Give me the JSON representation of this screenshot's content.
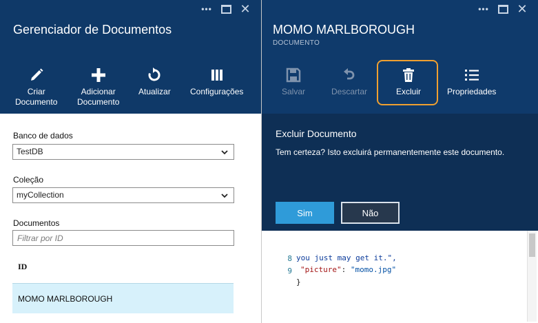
{
  "left_blade": {
    "title": "Gerenciador de Documentos",
    "window_controls": {
      "more": "•••"
    },
    "commands": [
      {
        "line1": "Criar",
        "line2": "Documento",
        "icon": "pencil-icon"
      },
      {
        "line1": "Adicionar",
        "line2": "Documento",
        "icon": "plus-icon"
      },
      {
        "line1": "Atualizar",
        "line2": "",
        "icon": "refresh-icon"
      },
      {
        "line1": "Configurações",
        "line2": "",
        "icon": "columns-icon"
      }
    ],
    "database": {
      "label": "Banco de dados",
      "value": "TestDB"
    },
    "collection": {
      "label": "Coleção",
      "value": "myCollection"
    },
    "documents": {
      "label": "Documentos",
      "placeholder": "Filtrar por ID",
      "column_header": "ID",
      "rows": [
        "MOMO MARLBOROUGH"
      ]
    }
  },
  "right_blade": {
    "title": "MOMO MARLBOROUGH",
    "subtitle": "DOCUMENTO",
    "window_controls": {
      "more": "•••"
    },
    "commands": [
      {
        "label": "Salvar",
        "icon": "save-icon",
        "enabled": false
      },
      {
        "label": "Descartar",
        "icon": "undo-icon",
        "enabled": false
      },
      {
        "label": "Excluir",
        "icon": "trash-icon",
        "enabled": true,
        "highlighted": true
      },
      {
        "label": "Propriedades",
        "icon": "list-icon",
        "enabled": true
      }
    ],
    "dialog": {
      "title": "Excluir Documento",
      "message": "Tem certeza? Isto excluirá permanentemente este documento.",
      "yes_label": "Sim",
      "no_label": "Não"
    },
    "code_lines": [
      {
        "number": "",
        "text": "you just may get it.\","
      },
      {
        "number": "8",
        "key": "\"picture\"",
        "sep": ": ",
        "value": "\"momo.jpg\""
      },
      {
        "number": "9",
        "text": "}"
      }
    ]
  },
  "colors": {
    "header_bg": "#0f3a6b",
    "dialog_bg": "#0e2f55",
    "accent_blue": "#2f9bd9",
    "highlight_orange": "#f0a030",
    "selected_row": "#d7f1fb"
  }
}
